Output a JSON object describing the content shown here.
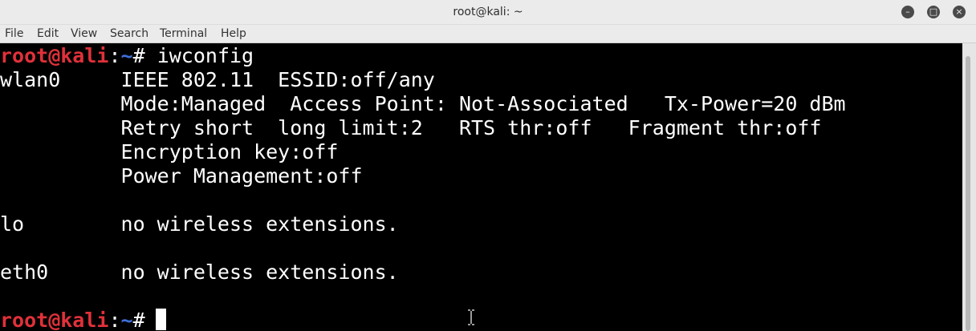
{
  "window": {
    "title": "root@kali: ~",
    "buttons": [
      "minimize-icon",
      "maximize-icon",
      "close-icon"
    ]
  },
  "menu": [
    "File",
    "Edit",
    "View",
    "Search",
    "Terminal",
    "Help"
  ],
  "terminal": {
    "prompt": {
      "user_host": "root@kali",
      "sep": ":",
      "path": "~",
      "symbol": "# "
    },
    "command": "iwconfig",
    "output": [
      "wlan0     IEEE 802.11  ESSID:off/any",
      "          Mode:Managed  Access Point: Not-Associated   Tx-Power=20 dBm",
      "          Retry short  long limit:2   RTS thr:off   Fragment thr:off",
      "          Encryption key:off",
      "          Power Management:off",
      "",
      "lo        no wireless extensions.",
      "",
      "eth0      no wireless extensions.",
      ""
    ]
  },
  "colors": {
    "prompt_user": "#e0313a",
    "prompt_path": "#3d6fd9",
    "background": "#000000",
    "text": "#ffffff"
  }
}
